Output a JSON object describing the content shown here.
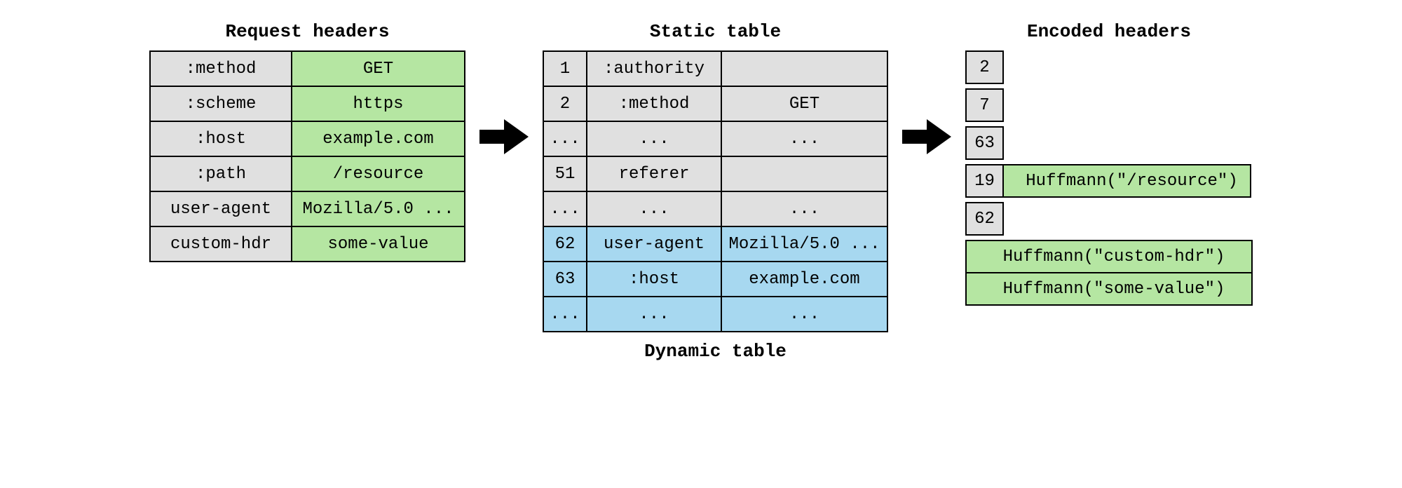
{
  "request": {
    "title": "Request headers",
    "rows": [
      {
        "name": ":method",
        "value": "GET"
      },
      {
        "name": ":scheme",
        "value": "https"
      },
      {
        "name": ":host",
        "value": "example.com"
      },
      {
        "name": ":path",
        "value": "/resource"
      },
      {
        "name": "user-agent",
        "value": "Mozilla/5.0 ..."
      },
      {
        "name": "custom-hdr",
        "value": "some-value"
      }
    ]
  },
  "static": {
    "title": "Static table",
    "rows": [
      {
        "idx": "1",
        "name": ":authority",
        "value": ""
      },
      {
        "idx": "2",
        "name": ":method",
        "value": "GET"
      },
      {
        "idx": "...",
        "name": "...",
        "value": "..."
      },
      {
        "idx": "51",
        "name": "referer",
        "value": ""
      },
      {
        "idx": "...",
        "name": "...",
        "value": "..."
      }
    ]
  },
  "dynamic": {
    "title": "Dynamic table",
    "rows": [
      {
        "idx": "62",
        "name": "user-agent",
        "value": "Mozilla/5.0 ..."
      },
      {
        "idx": "63",
        "name": ":host",
        "value": "example.com"
      },
      {
        "idx": "...",
        "name": "...",
        "value": "..."
      }
    ]
  },
  "encoded": {
    "title": "Encoded headers",
    "lines": [
      {
        "idx": "2",
        "body": ""
      },
      {
        "idx": "7",
        "body": ""
      },
      {
        "idx": "63",
        "body": ""
      },
      {
        "idx": "19",
        "body": "Huffmann(\"/resource\")"
      },
      {
        "idx": "62",
        "body": ""
      }
    ],
    "extras": [
      "Huffmann(\"custom-hdr\")",
      "Huffmann(\"some-value\")"
    ]
  }
}
